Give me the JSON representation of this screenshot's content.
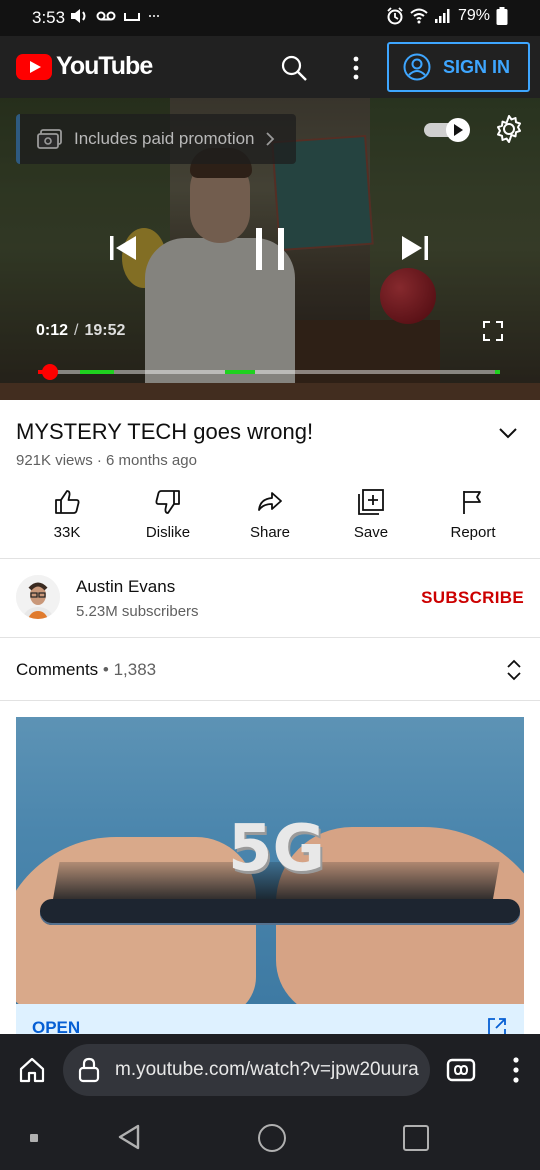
{
  "status_bar": {
    "time": "3:53",
    "battery": "79%"
  },
  "header": {
    "logo_text": "YouTube",
    "sign_in_label": "SIGN IN"
  },
  "player": {
    "promotion_label": "Includes paid promotion",
    "current_time": "0:12",
    "separator": "/",
    "duration": "19:52",
    "progress_fraction": 0.026,
    "ad_markers": [
      [
        0.09,
        0.165
      ],
      [
        0.405,
        0.47
      ],
      [
        0.99,
        1.0
      ]
    ]
  },
  "video": {
    "title": "MYSTERY TECH goes wrong!",
    "meta": "921K views · 6 months ago"
  },
  "actions": [
    {
      "label": "33K"
    },
    {
      "label": "Dislike"
    },
    {
      "label": "Share"
    },
    {
      "label": "Save"
    },
    {
      "label": "Report"
    }
  ],
  "channel": {
    "name": "Austin Evans",
    "subscribers": "5.23M subscribers",
    "subscribe_label": "SUBSCRIBE"
  },
  "comments": {
    "label": "Comments",
    "count": " • 1,383"
  },
  "ad": {
    "image_text": "5G",
    "open_label": "OPEN"
  },
  "browser": {
    "url": "m.youtube.com/watch?v=jpw20uura"
  },
  "colors": {
    "brand_red": "#ff0000",
    "subscribe_red": "#cc0000",
    "link_blue": "#3ea6ff",
    "ad_marker_green": "#1fd11f"
  }
}
